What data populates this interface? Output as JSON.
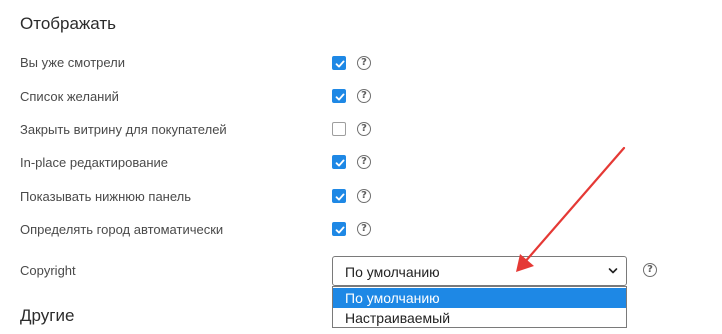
{
  "sections": {
    "display_title": "Отображать",
    "other_title": "Другие"
  },
  "settings": [
    {
      "label": "Вы уже смотрели",
      "checked": true
    },
    {
      "label": "Список желаний",
      "checked": true
    },
    {
      "label": "Закрыть витрину для покупателей",
      "checked": false
    },
    {
      "label": "In-place редактирование",
      "checked": true
    },
    {
      "label": "Показывать нижнюю панель",
      "checked": true
    },
    {
      "label": "Определять город автоматически",
      "checked": true
    }
  ],
  "help_glyph": "?",
  "copyright": {
    "label": "Copyright",
    "selected": "По умолчанию",
    "options": [
      "По умолчанию",
      "Настраиваемый"
    ],
    "highlighted_option": "По умолчанию"
  },
  "colors": {
    "accent": "#1e88e5",
    "arrow": "#e53935"
  },
  "icons": {
    "checkbox_checked": "check-icon",
    "help": "question-circle-icon",
    "dropdown": "chevron-down-icon",
    "annotation": "arrow-icon"
  }
}
